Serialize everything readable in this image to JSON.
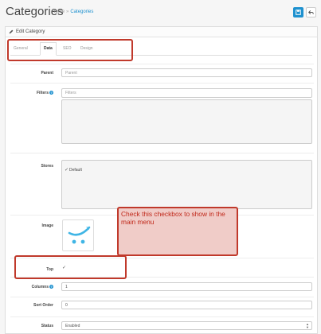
{
  "header": {
    "title": "Categories",
    "breadcrumb": {
      "home": "Home",
      "separator": "»",
      "current": "Categories"
    }
  },
  "panel": {
    "title": "Edit Category"
  },
  "tabs": [
    {
      "label": "General",
      "active": false
    },
    {
      "label": "Data",
      "active": true
    },
    {
      "label": "SEO",
      "active": false
    },
    {
      "label": "Design",
      "active": false
    }
  ],
  "form": {
    "parent": {
      "label": "Parent",
      "placeholder": "Parent"
    },
    "filters": {
      "label": "Filters",
      "placeholder": "Filters"
    },
    "stores": {
      "label": "Stores",
      "checked_option": "Default"
    },
    "image": {
      "label": "Image"
    },
    "top": {
      "label": "Top",
      "checked": true
    },
    "columns": {
      "label": "Columns",
      "value": "1"
    },
    "sort_order": {
      "label": "Sort Order",
      "value": "0"
    },
    "status": {
      "label": "Status",
      "value": "Enabled"
    }
  },
  "annotation": {
    "text": "Check this checkbox to show in the main menu"
  },
  "colors": {
    "accent": "#1e91cf",
    "annotation_border": "#c0392b",
    "annotation_fill": "#f0ccc8"
  }
}
